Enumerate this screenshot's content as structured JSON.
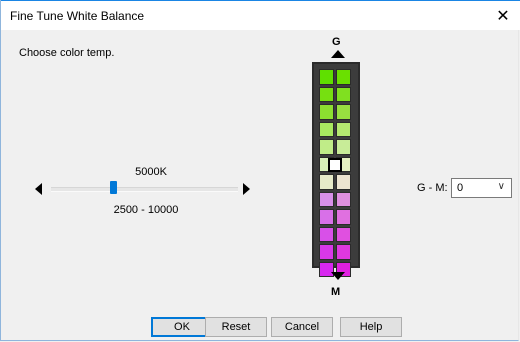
{
  "window": {
    "title": "Fine Tune White Balance",
    "close_glyph": "✕"
  },
  "instruction": "Choose color temp.",
  "temperature": {
    "value_label": "5000K",
    "range_label": "2500 - 10000",
    "value": 5000,
    "min": 2500,
    "max": 10000
  },
  "gm_bar": {
    "top_label": "G",
    "bottom_label": "M",
    "selected_level": 0,
    "cell_colors": [
      [
        "#5fe000",
        "#6ae000"
      ],
      [
        "#76e010",
        "#80e020"
      ],
      [
        "#8ce030",
        "#98e040"
      ],
      [
        "#a8e860",
        "#b4e870"
      ],
      [
        "#c0ec88",
        "#c8ec98"
      ],
      [
        "#d8f0b8",
        "#e4f0c0"
      ],
      [
        "#e6eac8",
        "#ece4d0"
      ],
      [
        "#d890e8",
        "#e090e0"
      ],
      [
        "#d870e8",
        "#e070e0"
      ],
      [
        "#d850e8",
        "#e050e0"
      ],
      [
        "#d838e8",
        "#e038e0"
      ],
      [
        "#d828f0",
        "#e020e0"
      ]
    ]
  },
  "gm_field": {
    "label": "G - M:",
    "value": "0"
  },
  "buttons": {
    "ok": "OK",
    "reset": "Reset",
    "cancel": "Cancel",
    "help": "Help"
  },
  "colors": {
    "accent": "#0078d7"
  }
}
